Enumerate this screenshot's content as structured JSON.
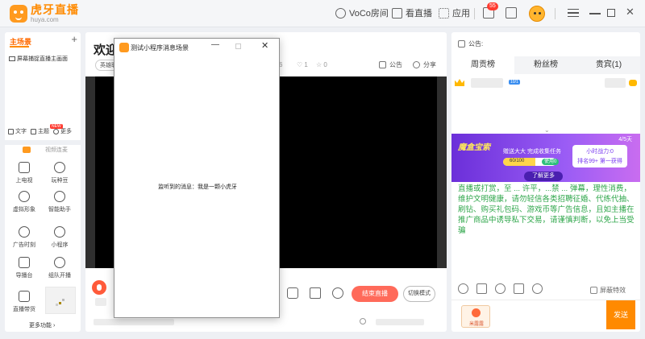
{
  "app": {
    "logo_title": "虎牙直播",
    "logo_domain": "huya.com"
  },
  "topbar": {
    "voco_label": "VoCo房间",
    "watch_label": "看直播",
    "apps_label": "应用",
    "notification_count": "55"
  },
  "sidebar": {
    "section_title": "主场景",
    "add_symbol": "+",
    "scene_item": "屏幕捕捉直播主画面",
    "tools": [
      {
        "label": "文字"
      },
      {
        "label": "主题"
      },
      {
        "label": "更多"
      }
    ],
    "new_badge": "NEW",
    "top_item_label": "视频连麦",
    "grid": [
      {
        "label": "上电视",
        "icon": "tv-icon"
      },
      {
        "label": "玩种豆",
        "icon": "leaf-icon"
      },
      {
        "label": "虚拟形象",
        "icon": "avatar-face-icon"
      },
      {
        "label": "智能助手",
        "icon": "smart-assistant-icon"
      },
      {
        "label": "广告时刻",
        "icon": "ad-clock-icon"
      },
      {
        "label": "小程序",
        "icon": "mini-program-icon"
      },
      {
        "label": "导播台",
        "icon": "director-icon"
      },
      {
        "label": "组队开播",
        "icon": "team-icon"
      },
      {
        "label": "直播带货",
        "icon": "shop-icon"
      }
    ],
    "more_features": "更多功能 ›"
  },
  "center": {
    "welcome": "欢迎",
    "hero_tag": "英雄联",
    "stats": [
      "6",
      "1",
      "0"
    ],
    "announce_label": "公告",
    "share_label": "分享",
    "end_live_label": "结束直播",
    "switch_mode_label": "切换模式"
  },
  "dialog": {
    "title": "测试小程序消息场景",
    "minimize": "—",
    "close": "✕",
    "message": "监听到的消息：我是一颗小虎牙"
  },
  "right": {
    "announce_label": "公告:",
    "tabs": [
      {
        "label": "周贡榜"
      },
      {
        "label": "粉丝榜"
      },
      {
        "label": "贵宾(1)"
      }
    ],
    "level_badge": "10/1",
    "banner": {
      "title": "魔盒宝索",
      "task": "赠送大大 完成收集任务",
      "progress_text": "60/100",
      "progress_value": 0.6,
      "use_label": "使用0",
      "page": "4/5天",
      "card_line1": "小时战力:0",
      "card_line2": "排名99+ 第一获得",
      "more_label": "了解更多"
    },
    "notice": "直播或打赏，至 ... 许平，...禁 ... 弹幕，理性消费，维护文明健康，请勿轻信各类招聘征婚、代练代抽、刷钻、购买礼包码、游戏币等广告信息，且如主播在推广商品中诱导私下交易，请谨慎判断，以免上当受骗",
    "shield_label": "屏蔽特效",
    "sticker_label": "米露露",
    "send_label": "发送"
  },
  "colors": {
    "brand_orange": "#ff8a00",
    "end_live_red": "#ff6a5a",
    "notice_green": "#2ea64a",
    "banner_purple": "#6b2fd9"
  }
}
